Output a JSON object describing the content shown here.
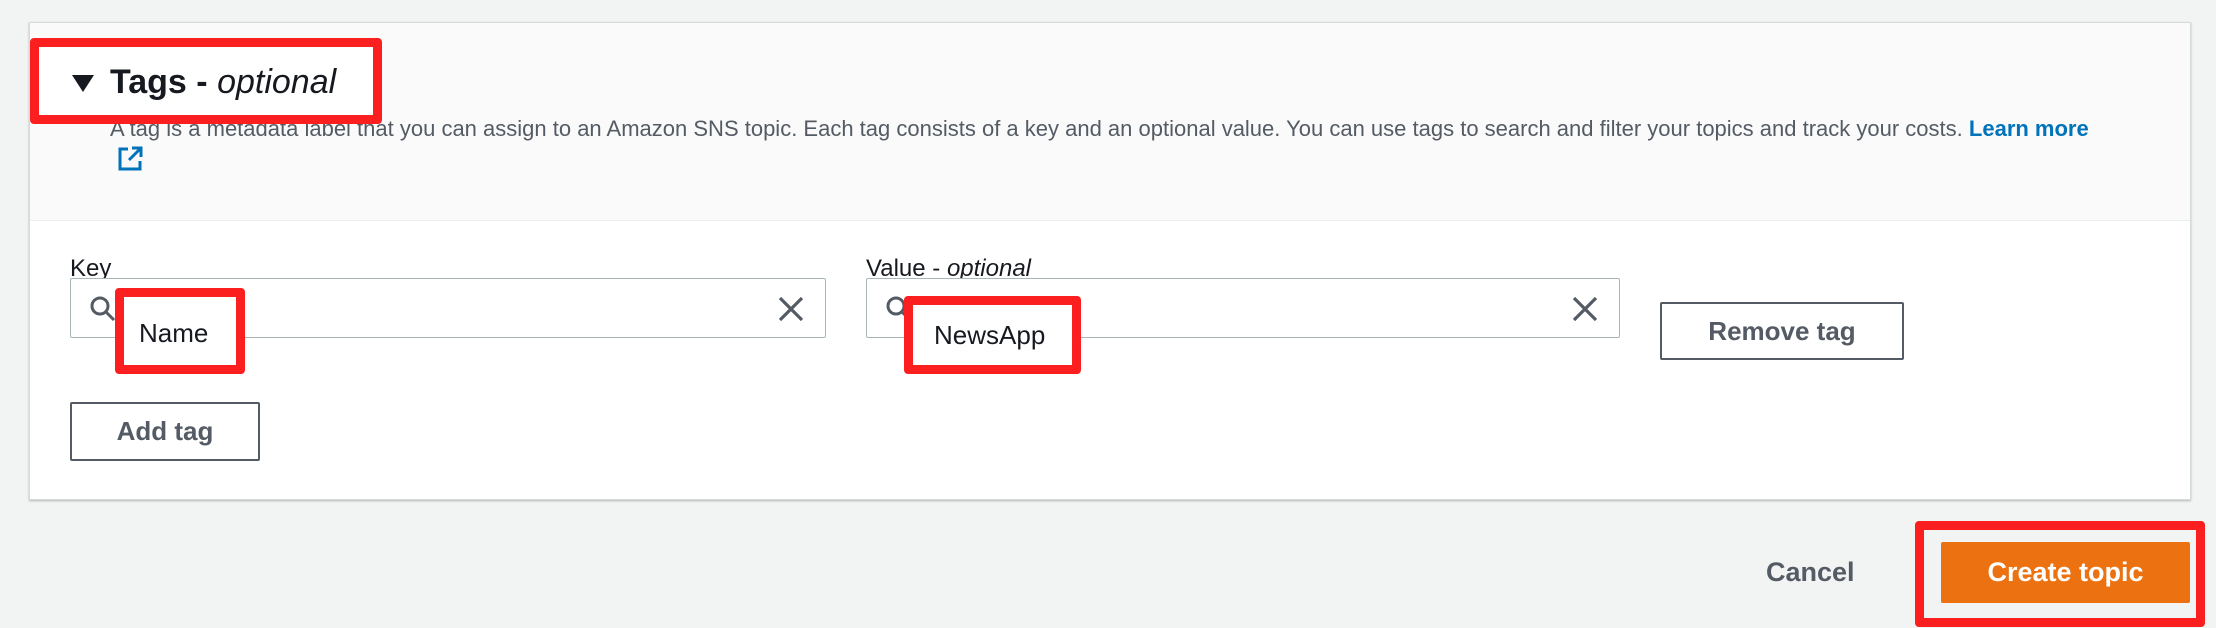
{
  "tags": {
    "title": "Tags",
    "title_separator": " - ",
    "title_optional": "optional",
    "description": "A tag is a metadata label that you can assign to an Amazon SNS topic. Each tag consists of a key and an optional value. You can use tags to search and filter your topics and track your costs.",
    "learn_more": "Learn more",
    "key_label": "Key",
    "value_label": "Value",
    "value_label_separator": " - ",
    "value_optional": "optional",
    "key_value": "Name",
    "value_value": "NewsApp",
    "remove_tag": "Remove tag",
    "add_tag": "Add tag"
  },
  "footer": {
    "cancel": "Cancel",
    "create_topic": "Create topic"
  },
  "icons": {
    "caret": "caret-down-icon",
    "search": "search-icon",
    "clear": "close-icon",
    "external": "external-link-icon"
  },
  "colors": {
    "link": "#0073bb",
    "primary": "#ec7211",
    "highlight": "#fb1f1f"
  }
}
